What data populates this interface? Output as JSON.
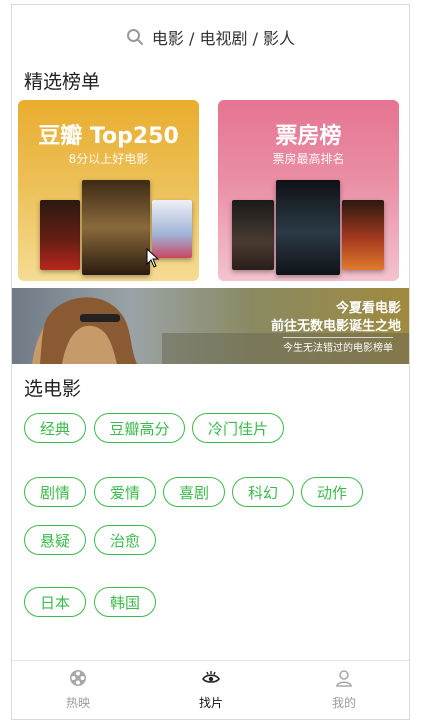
{
  "search": {
    "placeholder": "电影 / 电视剧 / 影人"
  },
  "featured": {
    "title": "精选榜单",
    "cards": [
      {
        "title": "豆瓣 Top250",
        "subtitle": "8分以上好电影",
        "color": "#e9b53e"
      },
      {
        "title": "票房榜",
        "subtitle": "票房最高排名",
        "color": "#e87a94"
      }
    ]
  },
  "banner": {
    "line1": "今夏看电影",
    "line2": "前往无数电影诞生之地",
    "line3": "今生无法错过的电影榜单"
  },
  "choose": {
    "title": "选电影",
    "rows": [
      [
        "经典",
        "豆瓣高分",
        "冷门佳片"
      ],
      [
        "剧情",
        "爱情",
        "喜剧",
        "科幻",
        "动作"
      ],
      [
        "悬疑",
        "治愈"
      ],
      [
        "日本",
        "韩国"
      ]
    ]
  },
  "tabbar": {
    "items": [
      {
        "label": "热映",
        "icon": "film-reel-icon",
        "active": false
      },
      {
        "label": "找片",
        "icon": "eye-icon",
        "active": true
      },
      {
        "label": "我的",
        "icon": "user-icon",
        "active": false
      }
    ],
    "active_color": "#111111",
    "inactive_color": "#9b9b9b"
  },
  "colors": {
    "accent": "#3cbb4c"
  }
}
